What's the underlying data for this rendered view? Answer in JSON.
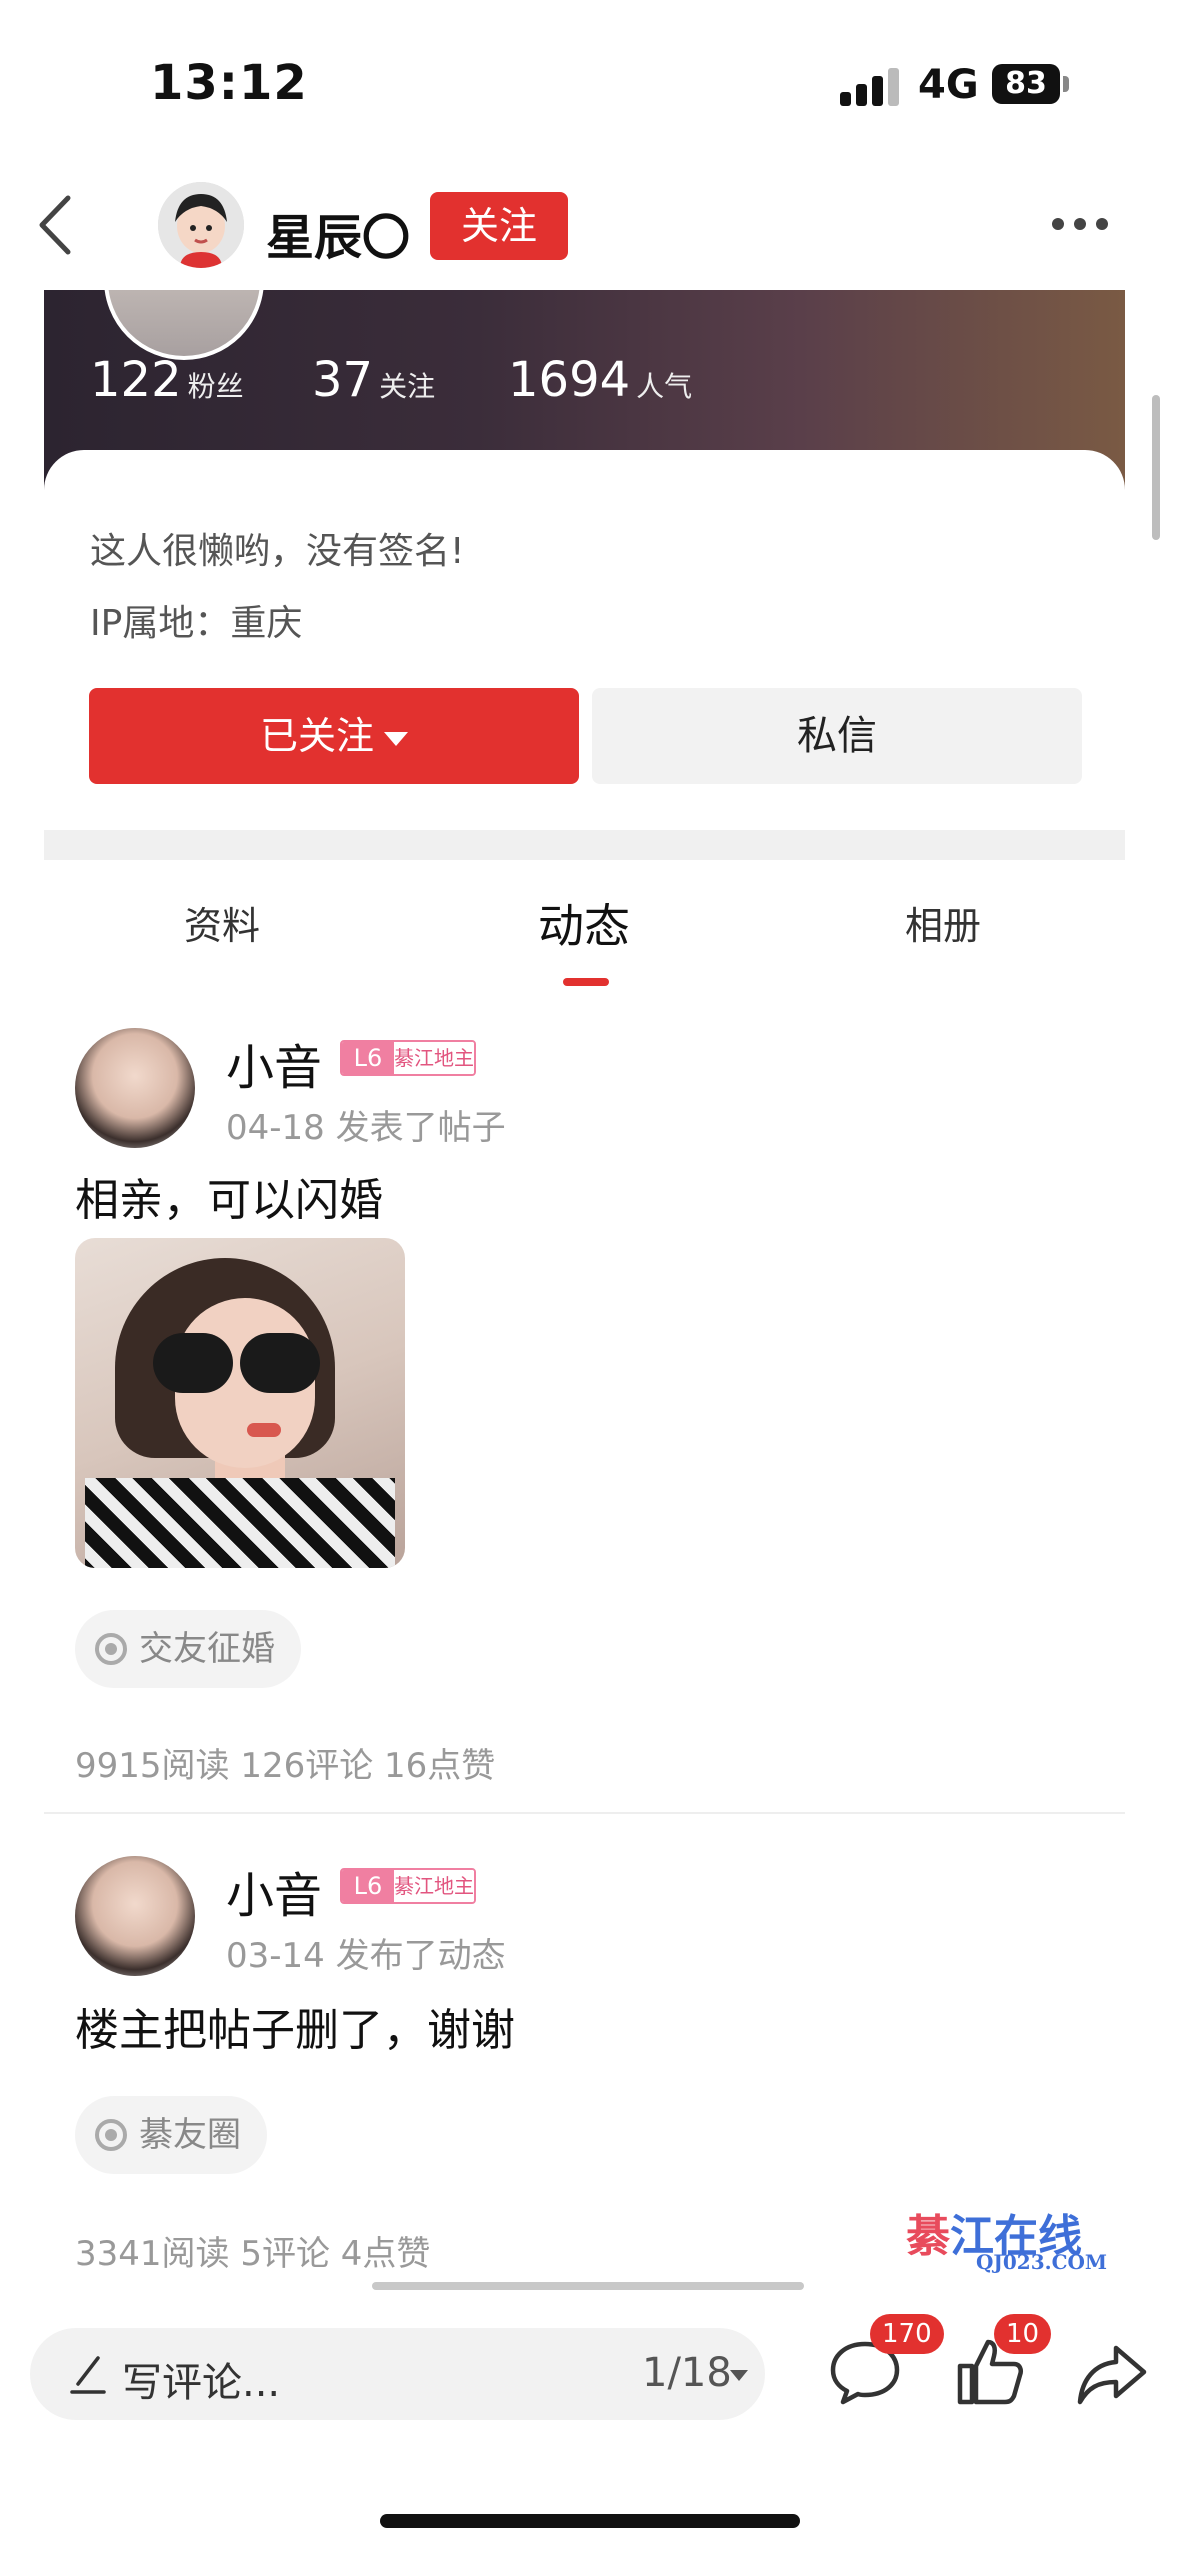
{
  "status_bar": {
    "time": "13:12",
    "network": "4G",
    "battery": "83"
  },
  "nav": {
    "username": "星辰〇",
    "follow_label": "关注"
  },
  "profile": {
    "stats": [
      {
        "value": "122",
        "label": "粉丝"
      },
      {
        "value": "37",
        "label": "关注"
      },
      {
        "value": "1694",
        "label": "人气"
      }
    ],
    "signature": "这人很懒哟，没有签名!",
    "ip_location": "IP属地：重庆",
    "followed_label": "已关注",
    "message_label": "私信"
  },
  "tabs": [
    {
      "label": "资料",
      "active": false
    },
    {
      "label": "动态",
      "active": true
    },
    {
      "label": "相册",
      "active": false
    }
  ],
  "posts": [
    {
      "user": "小音",
      "level": "L6",
      "title_badge": "綦江地主",
      "meta": "04-18 发表了帖子",
      "text": "相亲，可以闪婚",
      "has_image": true,
      "topic": "交友征婚",
      "stats": "9915阅读 126评论 16点赞"
    },
    {
      "user": "小音",
      "level": "L6",
      "title_badge": "綦江地主",
      "meta": "03-14 发布了动态",
      "text": "楼主把帖子删了，谢谢",
      "has_image": false,
      "topic": "綦友圈",
      "stats": "3341阅读 5评论 4点赞"
    }
  ],
  "watermark": {
    "main_part1": "綦",
    "main_part2": "江在线",
    "sub": "QJ023.COM"
  },
  "bottom_bar": {
    "comment_placeholder": "写评论...",
    "page_indicator": "1/18",
    "comment_count": "170",
    "like_count": "10"
  },
  "colors": {
    "accent": "#e2312f",
    "level_pink": "#f07fa1"
  }
}
